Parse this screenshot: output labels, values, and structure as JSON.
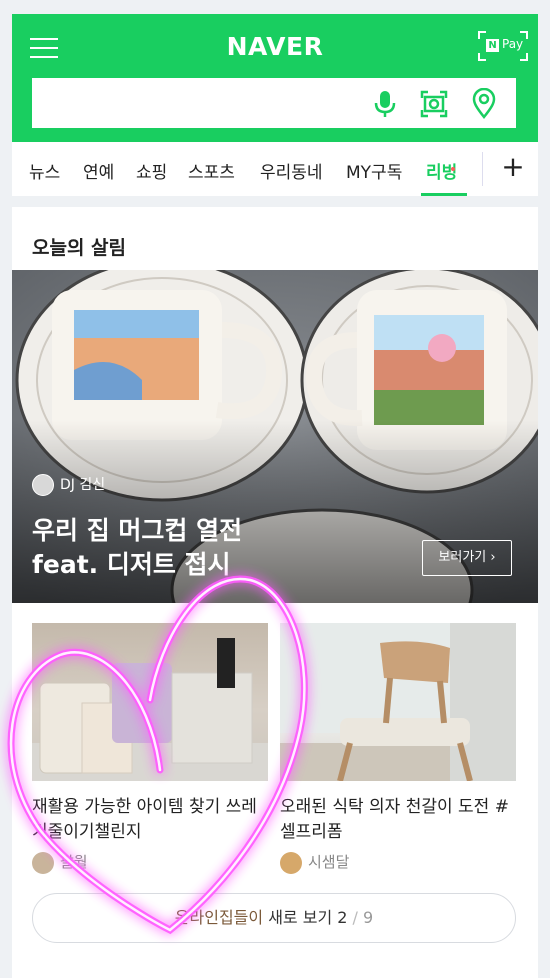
{
  "header": {
    "logo": "NAVER",
    "pay_badge": "N",
    "pay_text": "Pay",
    "search_placeholder": "",
    "brand_color": "#19ce60"
  },
  "tabs": [
    {
      "label": "뉴스",
      "active": false
    },
    {
      "label": "연예",
      "active": false
    },
    {
      "label": "쇼핑",
      "active": false
    },
    {
      "label": "스포츠",
      "active": false
    },
    {
      "label": "우리동네",
      "active": false
    },
    {
      "label": "MY구독",
      "active": false
    },
    {
      "label": "리빙",
      "active": true
    }
  ],
  "tabs_plus": "+",
  "section": {
    "title": "오늘의 살림"
  },
  "hero": {
    "author": "DJ 김신",
    "title_line1": "우리 집 머그컵 열전",
    "title_line2": "feat. 디저트 접시",
    "button": "보러가기 ›"
  },
  "items": [
    {
      "title": "재활용 가능한 아이템 찾기 쓰레기줄이기챌린지",
      "author": "팔월"
    },
    {
      "title": "오래된 식탁 의자 천갈이 도전 #셀프리폼",
      "author": "시샘달"
    }
  ],
  "more": {
    "prefix": "온라인집들이",
    "suffix": " 새로 보기 ",
    "current": "2",
    "separator": " / ",
    "total": "9"
  },
  "icons": [
    "menu-icon",
    "voice-search-icon",
    "lens-search-icon",
    "location-icon"
  ]
}
